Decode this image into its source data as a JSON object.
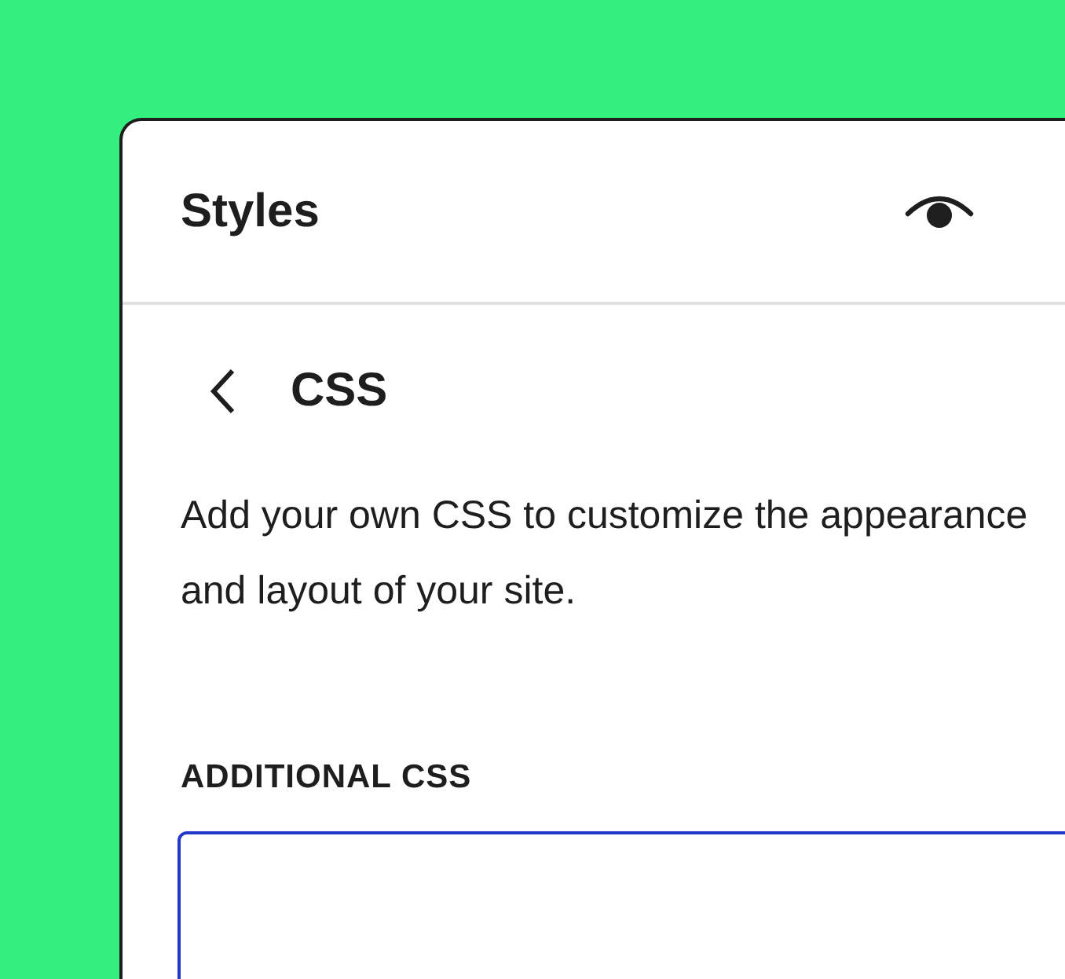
{
  "panel": {
    "title": "Styles"
  },
  "screen": {
    "title": "CSS",
    "description": "Add your own CSS to customize the appearance and layout of your site."
  },
  "css_field": {
    "label": "ADDITIONAL CSS",
    "focused": true
  }
}
